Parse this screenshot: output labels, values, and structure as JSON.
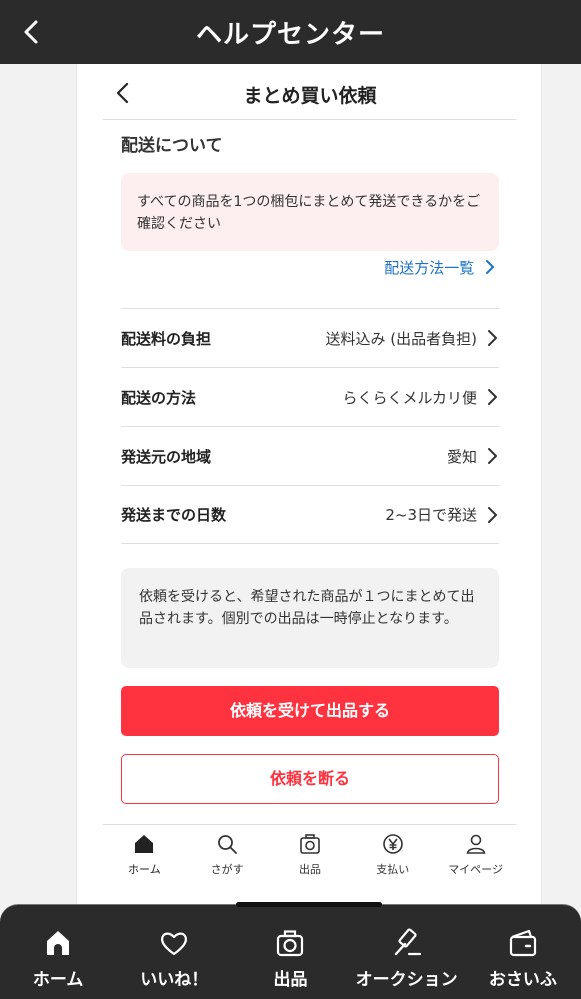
{
  "header": {
    "title": "ヘルプセンター"
  },
  "card": {
    "title": "まとめ買い依頼",
    "section_title": "配送について",
    "notice": "すべての商品を1つの梱包にまとめて発送できるかをご確認ください",
    "method_link": "配送方法一覧",
    "rows": [
      {
        "label": "配送料の負担",
        "value": "送料込み (出品者負担)"
      },
      {
        "label": "配送の方法",
        "value": "らくらくメルカリ便"
      },
      {
        "label": "発送元の地域",
        "value": "愛知"
      },
      {
        "label": "発送までの日数",
        "value": "2~3日で発送"
      }
    ],
    "info": "依頼を受けると、希望された商品が１つにまとめて出品されます。個別での出品は一時停止となります。",
    "accept_label": "依頼を受けて出品する",
    "decline_label": "依頼を断る",
    "nav": [
      {
        "label": "ホーム",
        "icon": "home-icon"
      },
      {
        "label": "さがす",
        "icon": "search-icon"
      },
      {
        "label": "出品",
        "icon": "camera-icon"
      },
      {
        "label": "支払い",
        "icon": "yen-icon"
      },
      {
        "label": "マイページ",
        "icon": "person-icon"
      }
    ]
  },
  "tabbar": {
    "tabs": [
      {
        "label": "ホーム",
        "icon": "home-icon"
      },
      {
        "label": "いいね！",
        "icon": "heart-icon"
      },
      {
        "label": "出品",
        "icon": "camera-icon"
      },
      {
        "label": "オークション",
        "icon": "gavel-icon"
      },
      {
        "label": "おさいふ",
        "icon": "wallet-icon"
      }
    ]
  },
  "colors": {
    "accent": "#ff333f",
    "link": "#1a73c8",
    "dark_bar": "#2b2b2b",
    "notice_bg": "#fdeef0"
  }
}
